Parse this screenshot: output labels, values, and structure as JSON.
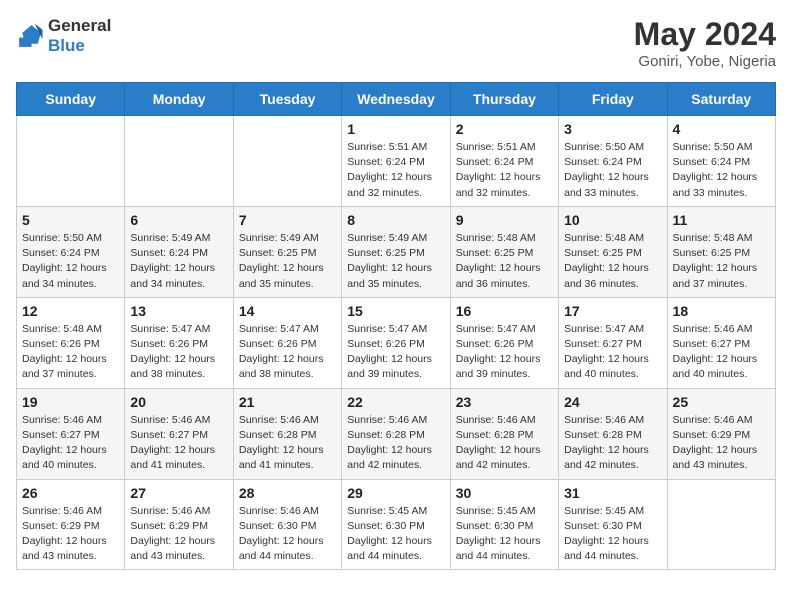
{
  "header": {
    "logo_line1": "General",
    "logo_line2": "Blue",
    "month_year": "May 2024",
    "location": "Goniri, Yobe, Nigeria"
  },
  "days_of_week": [
    "Sunday",
    "Monday",
    "Tuesday",
    "Wednesday",
    "Thursday",
    "Friday",
    "Saturday"
  ],
  "weeks": [
    [
      {
        "day": "",
        "info": ""
      },
      {
        "day": "",
        "info": ""
      },
      {
        "day": "",
        "info": ""
      },
      {
        "day": "1",
        "info": "Sunrise: 5:51 AM\nSunset: 6:24 PM\nDaylight: 12 hours and 32 minutes."
      },
      {
        "day": "2",
        "info": "Sunrise: 5:51 AM\nSunset: 6:24 PM\nDaylight: 12 hours and 32 minutes."
      },
      {
        "day": "3",
        "info": "Sunrise: 5:50 AM\nSunset: 6:24 PM\nDaylight: 12 hours and 33 minutes."
      },
      {
        "day": "4",
        "info": "Sunrise: 5:50 AM\nSunset: 6:24 PM\nDaylight: 12 hours and 33 minutes."
      }
    ],
    [
      {
        "day": "5",
        "info": "Sunrise: 5:50 AM\nSunset: 6:24 PM\nDaylight: 12 hours and 34 minutes."
      },
      {
        "day": "6",
        "info": "Sunrise: 5:49 AM\nSunset: 6:24 PM\nDaylight: 12 hours and 34 minutes."
      },
      {
        "day": "7",
        "info": "Sunrise: 5:49 AM\nSunset: 6:25 PM\nDaylight: 12 hours and 35 minutes."
      },
      {
        "day": "8",
        "info": "Sunrise: 5:49 AM\nSunset: 6:25 PM\nDaylight: 12 hours and 35 minutes."
      },
      {
        "day": "9",
        "info": "Sunrise: 5:48 AM\nSunset: 6:25 PM\nDaylight: 12 hours and 36 minutes."
      },
      {
        "day": "10",
        "info": "Sunrise: 5:48 AM\nSunset: 6:25 PM\nDaylight: 12 hours and 36 minutes."
      },
      {
        "day": "11",
        "info": "Sunrise: 5:48 AM\nSunset: 6:25 PM\nDaylight: 12 hours and 37 minutes."
      }
    ],
    [
      {
        "day": "12",
        "info": "Sunrise: 5:48 AM\nSunset: 6:26 PM\nDaylight: 12 hours and 37 minutes."
      },
      {
        "day": "13",
        "info": "Sunrise: 5:47 AM\nSunset: 6:26 PM\nDaylight: 12 hours and 38 minutes."
      },
      {
        "day": "14",
        "info": "Sunrise: 5:47 AM\nSunset: 6:26 PM\nDaylight: 12 hours and 38 minutes."
      },
      {
        "day": "15",
        "info": "Sunrise: 5:47 AM\nSunset: 6:26 PM\nDaylight: 12 hours and 39 minutes."
      },
      {
        "day": "16",
        "info": "Sunrise: 5:47 AM\nSunset: 6:26 PM\nDaylight: 12 hours and 39 minutes."
      },
      {
        "day": "17",
        "info": "Sunrise: 5:47 AM\nSunset: 6:27 PM\nDaylight: 12 hours and 40 minutes."
      },
      {
        "day": "18",
        "info": "Sunrise: 5:46 AM\nSunset: 6:27 PM\nDaylight: 12 hours and 40 minutes."
      }
    ],
    [
      {
        "day": "19",
        "info": "Sunrise: 5:46 AM\nSunset: 6:27 PM\nDaylight: 12 hours and 40 minutes."
      },
      {
        "day": "20",
        "info": "Sunrise: 5:46 AM\nSunset: 6:27 PM\nDaylight: 12 hours and 41 minutes."
      },
      {
        "day": "21",
        "info": "Sunrise: 5:46 AM\nSunset: 6:28 PM\nDaylight: 12 hours and 41 minutes."
      },
      {
        "day": "22",
        "info": "Sunrise: 5:46 AM\nSunset: 6:28 PM\nDaylight: 12 hours and 42 minutes."
      },
      {
        "day": "23",
        "info": "Sunrise: 5:46 AM\nSunset: 6:28 PM\nDaylight: 12 hours and 42 minutes."
      },
      {
        "day": "24",
        "info": "Sunrise: 5:46 AM\nSunset: 6:28 PM\nDaylight: 12 hours and 42 minutes."
      },
      {
        "day": "25",
        "info": "Sunrise: 5:46 AM\nSunset: 6:29 PM\nDaylight: 12 hours and 43 minutes."
      }
    ],
    [
      {
        "day": "26",
        "info": "Sunrise: 5:46 AM\nSunset: 6:29 PM\nDaylight: 12 hours and 43 minutes."
      },
      {
        "day": "27",
        "info": "Sunrise: 5:46 AM\nSunset: 6:29 PM\nDaylight: 12 hours and 43 minutes."
      },
      {
        "day": "28",
        "info": "Sunrise: 5:46 AM\nSunset: 6:30 PM\nDaylight: 12 hours and 44 minutes."
      },
      {
        "day": "29",
        "info": "Sunrise: 5:45 AM\nSunset: 6:30 PM\nDaylight: 12 hours and 44 minutes."
      },
      {
        "day": "30",
        "info": "Sunrise: 5:45 AM\nSunset: 6:30 PM\nDaylight: 12 hours and 44 minutes."
      },
      {
        "day": "31",
        "info": "Sunrise: 5:45 AM\nSunset: 6:30 PM\nDaylight: 12 hours and 44 minutes."
      },
      {
        "day": "",
        "info": ""
      }
    ]
  ]
}
